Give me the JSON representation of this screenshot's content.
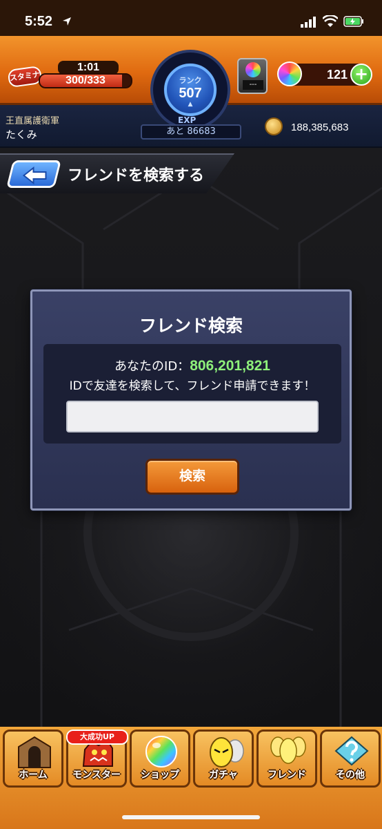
{
  "status_bar": {
    "time": "5:52"
  },
  "header": {
    "stamina_label": "スタミナ",
    "stamina_timer": "1:01",
    "stamina_value": "300/333",
    "stamina_fraction": 0.9,
    "rank_label": "ランク",
    "rank_value": "507",
    "exp_label": "EXP",
    "exp_remaining": "あと 86683",
    "orb_slot_label": "---",
    "orb_count": "121",
    "guild_name": "王直属護衛軍",
    "username": "たくみ",
    "coin_count": "188,385,683"
  },
  "page": {
    "title": "フレンドを検索する"
  },
  "dialog": {
    "title": "フレンド検索",
    "id_prefix": "あなたのID：",
    "id_value": "806,201,821",
    "description": "IDで友達を検索して、フレンド申請できます！",
    "input_value": "",
    "search_button": "検索"
  },
  "bottom_nav": {
    "badge": "大成功UP",
    "items": [
      {
        "label": "ホーム",
        "icon": "home-icon"
      },
      {
        "label": "モンスター",
        "icon": "monster-icon"
      },
      {
        "label": "ショップ",
        "icon": "shop-orb-icon"
      },
      {
        "label": "ガチャ",
        "icon": "gacha-egg-icon"
      },
      {
        "label": "フレンド",
        "icon": "friend-icon"
      },
      {
        "label": "その他",
        "icon": "other-icon"
      }
    ]
  },
  "colors": {
    "header_orange": "#e06a10",
    "id_green": "#8ef07a",
    "dialog_bg": "#2a3050",
    "button_orange": "#d8620e"
  }
}
